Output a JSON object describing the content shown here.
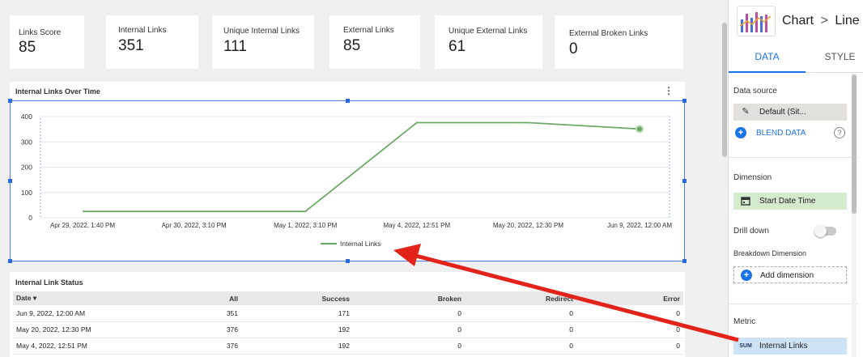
{
  "scorecards": [
    {
      "label": "Links Score",
      "value": "85"
    },
    {
      "label": "Internal Links",
      "value": "351"
    },
    {
      "label": "Unique Internal Links",
      "value": "111"
    },
    {
      "label": "External Links",
      "value": "85"
    },
    {
      "label": "Unique External Links",
      "value": "61"
    },
    {
      "label": "External Broken Links",
      "value": "0"
    }
  ],
  "chart": {
    "title": "Internal Links Over Time",
    "menu_glyph": "⋮"
  },
  "chart_data": {
    "type": "line",
    "x": [
      "Apr 29, 2022, 1:40 PM",
      "Apr 30, 2022, 3:10 PM",
      "May 1, 2022, 3:10 PM",
      "May 4, 2022, 12:51 PM",
      "May 20, 2022, 12:30 PM",
      "Jun 9, 2022, 12:00 AM"
    ],
    "series": [
      {
        "name": "Internal Links",
        "values": [
          25,
          25,
          25,
          376,
          376,
          351
        ],
        "color": "#6aaa64"
      }
    ],
    "ylim": [
      0,
      400
    ],
    "yticks": [
      0,
      100,
      200,
      300,
      400
    ],
    "grid": true,
    "legend": "bottom-center"
  },
  "table": {
    "title": "Internal Link Status",
    "columns": [
      "Date",
      "All",
      "Success",
      "Broken",
      "Redirect",
      "Error"
    ],
    "sort_indicator": "▾",
    "rows": [
      [
        "Jun 9, 2022, 12:00 AM",
        "351",
        "171",
        "0",
        "0",
        "0"
      ],
      [
        "May 20, 2022, 12:30 PM",
        "376",
        "192",
        "0",
        "0",
        "0"
      ],
      [
        "May 4, 2022, 12:51 PM",
        "376",
        "192",
        "0",
        "0",
        "0"
      ]
    ]
  },
  "panel": {
    "chart_type": "Chart",
    "chart_subtype": "Line",
    "breadcrumb_sep": ">",
    "tab_data": "DATA",
    "tab_style": "STYLE",
    "data_source_label": "Data source",
    "data_source_value": "Default (Sit...",
    "blend_label": "BLEND DATA",
    "dimension_label": "Dimension",
    "dimension_value": "Start Date Time",
    "drill_down_label": "Drill down",
    "breakdown_label": "Breakdown Dimension",
    "add_dimension_label": "Add dimension",
    "metric_label": "Metric",
    "metric_agg": "SUM",
    "metric_value": "Internal Links"
  },
  "annotation": {
    "arrow_color": "#e32219"
  }
}
